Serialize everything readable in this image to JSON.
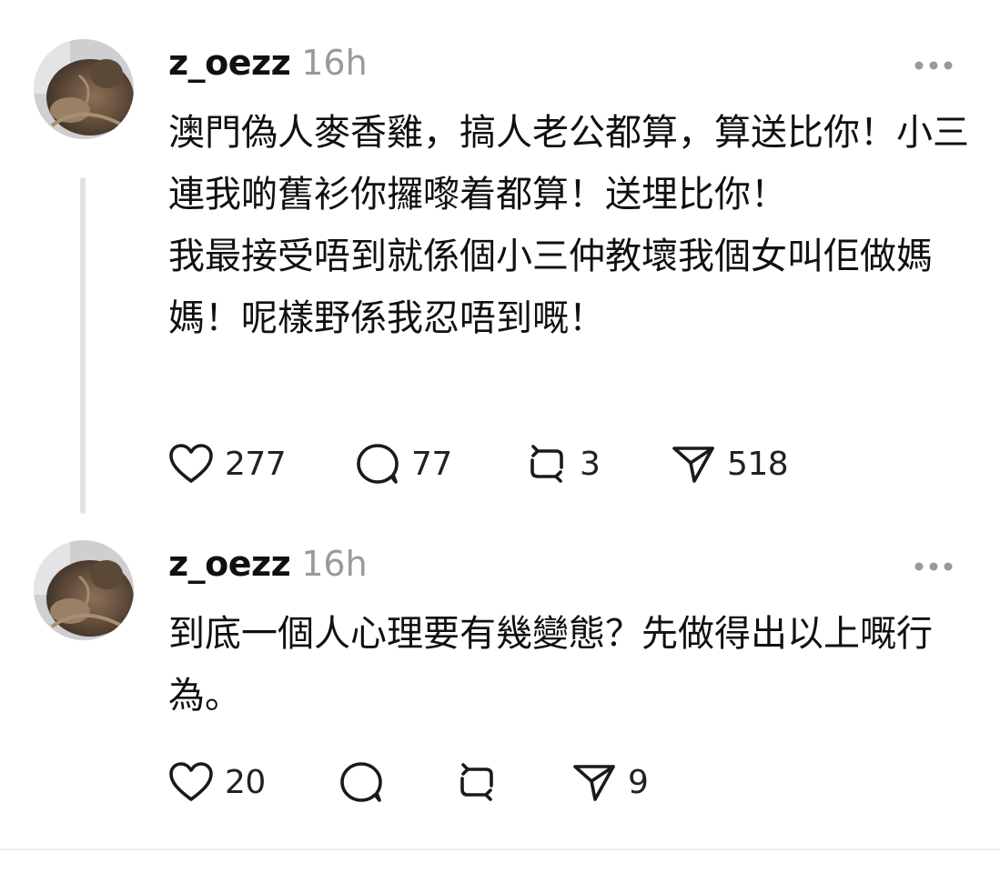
{
  "posts": [
    {
      "username": "z_oezz",
      "time": "16h",
      "text": [
        "澳門偽人麥香雞，搞人老公都算，算送比你！小三連我啲舊衫你攞嚟着都算！送埋比你！",
        "我最接受唔到就係個小三仲教壞我個女叫佢做媽媽！呢樣野係我忍唔到嘅！"
      ],
      "likes": "277",
      "replies": "77",
      "reposts": "3",
      "shares": "518"
    },
    {
      "username": "z_oezz",
      "time": "16h",
      "text": [
        "到底一個人心理要有幾變態？先做得出以上嘅行為。"
      ],
      "likes": "20",
      "replies": "",
      "reposts": "",
      "shares": "9"
    }
  ],
  "icons": {
    "like": "heart-icon",
    "reply": "comment-icon",
    "repost": "repost-icon",
    "share": "send-icon",
    "more": "more-icon"
  },
  "colors": {
    "text": "#101010",
    "muted": "#9a9a9a",
    "thread_line": "#e3e3e3"
  }
}
